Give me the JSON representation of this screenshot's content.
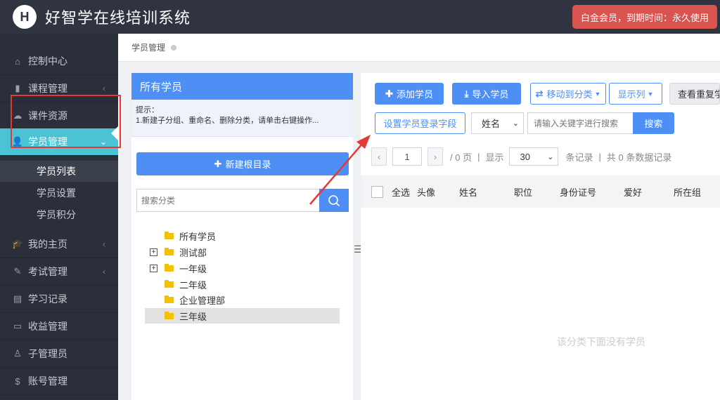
{
  "header": {
    "logo_letter": "H",
    "title": "好智学在线培训系统",
    "vip_badge": "白金会员，到期时间：永久使用"
  },
  "sidebar": {
    "items": [
      {
        "label": "控制中心",
        "icon": "home-icon"
      },
      {
        "label": "课程管理",
        "icon": "book-icon"
      },
      {
        "label": "课件资源",
        "icon": "cloud-icon"
      },
      {
        "label": "学员管理",
        "icon": "user-icon"
      },
      {
        "label": "我的主页",
        "icon": "graduation-cap-icon"
      },
      {
        "label": "考试管理",
        "icon": "edit-icon"
      },
      {
        "label": "学习记录",
        "icon": "notebook-icon"
      },
      {
        "label": "收益管理",
        "icon": "card-icon"
      },
      {
        "label": "子管理员",
        "icon": "admin-icon"
      },
      {
        "label": "账号管理",
        "icon": "dollar-icon"
      }
    ],
    "sub_items": [
      {
        "label": "学员列表"
      },
      {
        "label": "学员设置"
      },
      {
        "label": "学员积分"
      }
    ]
  },
  "breadcrumb": {
    "current": "学员管理"
  },
  "category_panel": {
    "title": "所有学员",
    "tip_line1": "提示：",
    "tip_line2": "1.新建子分组、重命名、删除分类，请单击右键操作...",
    "new_root_label": "新建根目录",
    "search_placeholder": "搜索分类",
    "tree": [
      {
        "label": "所有学员",
        "expandable": false
      },
      {
        "label": "测试部",
        "expandable": true
      },
      {
        "label": "一年级",
        "expandable": true
      },
      {
        "label": "二年级",
        "expandable": false
      },
      {
        "label": "企业管理部",
        "expandable": false
      },
      {
        "label": "三年级",
        "expandable": false,
        "selected": true
      }
    ]
  },
  "toolbar": {
    "add_label": "添加学员",
    "import_label": "导入学员",
    "move_label": "移动到分类",
    "columns_label": "显示列",
    "duplicates_label": "查看重复学",
    "login_fields_label": "设置学员登录字段",
    "search_field_selected": "姓名",
    "keyword_placeholder": "请输入关键字进行搜索",
    "search_label": "搜索"
  },
  "pager": {
    "page_value": "1",
    "total_pages_text": "/ 0 页",
    "show_text": "显示",
    "page_size": "30",
    "records_text": "条记录",
    "total_text": "共 0 条数据记录"
  },
  "table": {
    "columns": [
      "全选",
      "头像",
      "姓名",
      "职位",
      "身份证号",
      "爱好",
      "所在组"
    ]
  },
  "empty_message": "该分类下面没有学员",
  "colors": {
    "accent": "#4d8ff5",
    "sidebar_active": "#4bc3d4",
    "annotation": "#e53935",
    "header_bg": "#2f3440",
    "vip_badge": "#d9534f"
  }
}
